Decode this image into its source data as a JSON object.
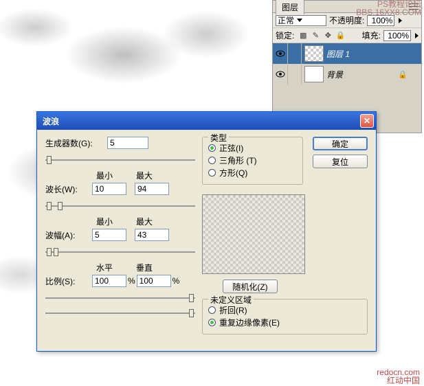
{
  "watermark": {
    "top1": "PS教程论坛",
    "top2": "BBS.16XX8.COM",
    "bot1": "redocn.com",
    "bot2": "红动中国"
  },
  "layers_panel": {
    "tab": "图层",
    "blend_label": "正常",
    "opacity_label": "不透明度:",
    "opacity_value": "100%",
    "lock_label": "锁定:",
    "fill_label": "填充:",
    "fill_value": "100%",
    "items": [
      {
        "name": "图层 1",
        "selected": true,
        "transparent": true
      },
      {
        "name": "背景",
        "selected": false,
        "transparent": false,
        "locked": true
      }
    ]
  },
  "dialog": {
    "title": "波浪",
    "generators_label": "生成器数(G):",
    "generators_value": "5",
    "min_label": "最小",
    "max_label": "最大",
    "wavelength_label": "波长(W):",
    "wavelength_min": "10",
    "wavelength_max": "94",
    "amplitude_label": "波幅(A):",
    "amplitude_min": "5",
    "amplitude_max": "43",
    "horiz_label": "水平",
    "vert_label": "垂直",
    "scale_label": "比例(S):",
    "scale_h": "100",
    "scale_v": "100",
    "pct": "%",
    "type_legend": "类型",
    "type": {
      "sine": "正弦(I)",
      "triangle": "三角形 (T)",
      "square": "方形(Q)"
    },
    "ok": "确定",
    "reset": "复位",
    "randomize": "随机化(Z)",
    "undef_legend": "未定义区域",
    "undef": {
      "wrap": "折回(R)",
      "repeat": "重复边缘像素(E)"
    }
  }
}
